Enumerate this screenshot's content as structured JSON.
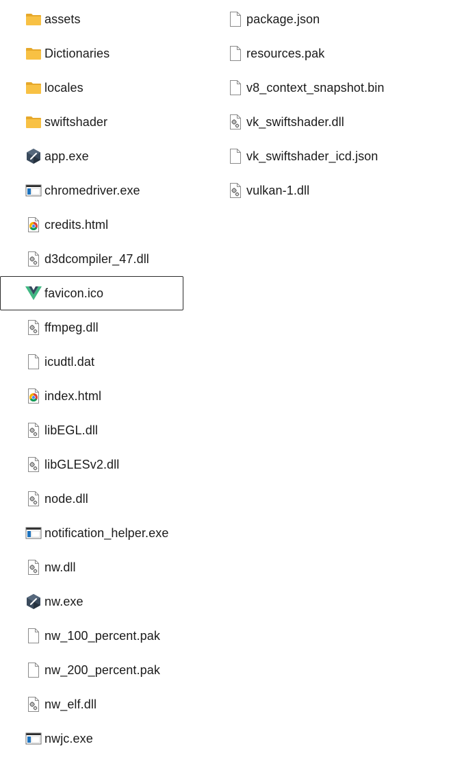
{
  "explorer": {
    "columns": [
      {
        "items": [
          {
            "name": "assets",
            "icon": "folder-icon"
          },
          {
            "name": "Dictionaries",
            "icon": "folder-icon"
          },
          {
            "name": "locales",
            "icon": "folder-icon"
          },
          {
            "name": "swiftshader",
            "icon": "folder-icon"
          },
          {
            "name": "app.exe",
            "icon": "nwjs-app-icon"
          },
          {
            "name": "chromedriver.exe",
            "icon": "exe-window-icon"
          },
          {
            "name": "credits.html",
            "icon": "chrome-html-icon"
          },
          {
            "name": "d3dcompiler_47.dll",
            "icon": "dll-gear-icon"
          },
          {
            "name": "favicon.ico",
            "icon": "vue-logo-icon",
            "selected": true
          },
          {
            "name": "ffmpeg.dll",
            "icon": "dll-gear-icon"
          },
          {
            "name": "icudtl.dat",
            "icon": "blank-file-icon"
          },
          {
            "name": "index.html",
            "icon": "chrome-html-icon"
          },
          {
            "name": "libEGL.dll",
            "icon": "dll-gear-icon"
          },
          {
            "name": "libGLESv2.dll",
            "icon": "dll-gear-icon"
          },
          {
            "name": "node.dll",
            "icon": "dll-gear-icon"
          },
          {
            "name": "notification_helper.exe",
            "icon": "exe-window-icon"
          },
          {
            "name": "nw.dll",
            "icon": "dll-gear-icon"
          },
          {
            "name": "nw.exe",
            "icon": "nwjs-app-icon"
          },
          {
            "name": "nw_100_percent.pak",
            "icon": "blank-file-icon"
          },
          {
            "name": "nw_200_percent.pak",
            "icon": "blank-file-icon"
          },
          {
            "name": "nw_elf.dll",
            "icon": "dll-gear-icon"
          },
          {
            "name": "nwjc.exe",
            "icon": "exe-window-icon"
          }
        ]
      },
      {
        "items": [
          {
            "name": "package.json",
            "icon": "blank-file-icon"
          },
          {
            "name": "resources.pak",
            "icon": "blank-file-icon"
          },
          {
            "name": "v8_context_snapshot.bin",
            "icon": "blank-file-icon"
          },
          {
            "name": "vk_swiftshader.dll",
            "icon": "dll-gear-icon"
          },
          {
            "name": "vk_swiftshader_icd.json",
            "icon": "blank-file-icon"
          },
          {
            "name": "vulkan-1.dll",
            "icon": "dll-gear-icon"
          }
        ]
      }
    ],
    "colors": {
      "folder": "#F8C144",
      "folder_dark": "#E6A82B",
      "selection_border": "#2B2B2B",
      "exe_blue": "#1E73BE",
      "vue_green": "#41B883",
      "vue_dark": "#35495E"
    }
  }
}
